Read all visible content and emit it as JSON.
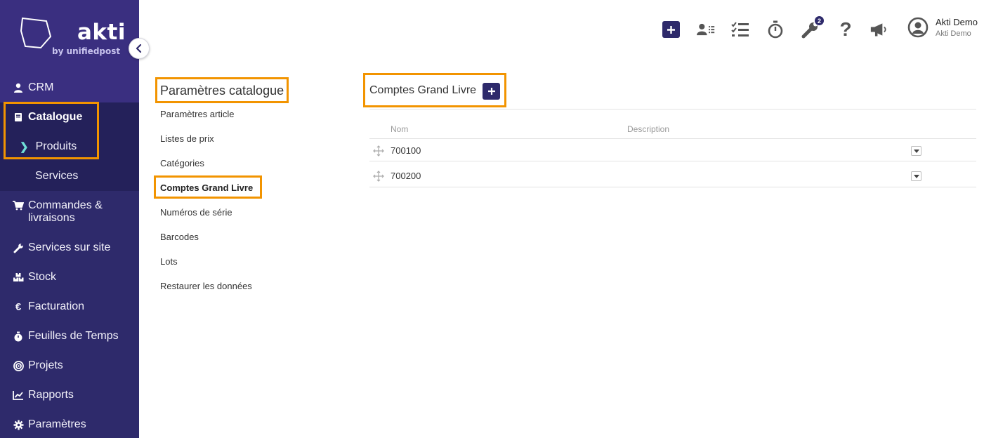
{
  "brand": {
    "name": "akti",
    "sub": "by unifiedpost"
  },
  "sidebar": {
    "items": [
      {
        "label": "CRM",
        "icon": "user-icon"
      },
      {
        "label": "Catalogue",
        "icon": "book-icon"
      },
      {
        "label": "Produits"
      },
      {
        "label": "Services"
      },
      {
        "label": "Commandes & livraisons",
        "icon": "cart-icon"
      },
      {
        "label": "Services sur site",
        "icon": "wrench-icon"
      },
      {
        "label": "Stock",
        "icon": "boxes-icon"
      },
      {
        "label": "Facturation",
        "icon": "euro-icon"
      },
      {
        "label": "Feuilles de Temps",
        "icon": "stopwatch-icon"
      },
      {
        "label": "Projets",
        "icon": "target-icon"
      },
      {
        "label": "Rapports",
        "icon": "chart-icon"
      },
      {
        "label": "Paramètres",
        "icon": "gear-icon"
      }
    ]
  },
  "topbar": {
    "notification_count": "2",
    "user": {
      "name": "Akti Demo",
      "company": "Akti Demo"
    }
  },
  "settings_menu": {
    "title": "Paramètres catalogue",
    "links": [
      "Paramètres article",
      "Listes de prix",
      "Catégories",
      "Comptes Grand Livre",
      "Numéros de série",
      "Barcodes",
      "Lots",
      "Restaurer les données"
    ]
  },
  "content": {
    "title": "Comptes Grand Livre",
    "columns": {
      "name": "Nom",
      "description": "Description"
    },
    "rows": [
      {
        "name": "700100",
        "description": ""
      },
      {
        "name": "700200",
        "description": ""
      }
    ]
  },
  "colors": {
    "sidebar": "#2e2a6b",
    "highlight": "#f29400",
    "accent": "#6fe0d8"
  }
}
